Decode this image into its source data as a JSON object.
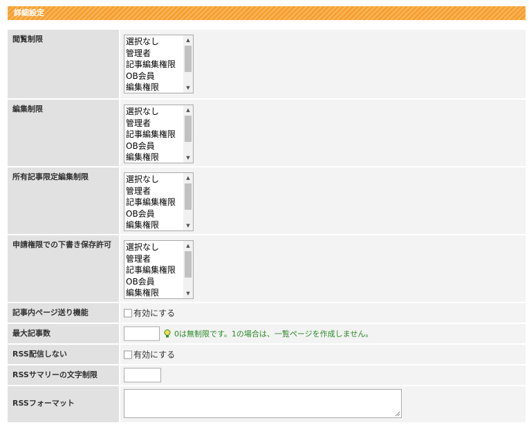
{
  "section": {
    "title": "詳細設定"
  },
  "permission_options": [
    "選択なし",
    "管理者",
    "記事編集権限",
    "OB会員",
    "編集権限"
  ],
  "rows": {
    "view_restriction": {
      "label": "閲覧制限"
    },
    "edit_restriction": {
      "label": "編集制限"
    },
    "owned_edit_restriction": {
      "label": "所有記事限定編集制限"
    },
    "draft_save_permission": {
      "label": "申請権限での下書き保存許可"
    },
    "in_article_paging": {
      "label": "記事内ページ送り機能",
      "checkbox_label": "有効にする",
      "checked": false
    },
    "max_articles": {
      "label": "最大記事数",
      "value": "",
      "hint": "0は無制限です。1の場合は、一覧ページを作成しません。"
    },
    "no_rss": {
      "label": "RSS配信しない",
      "checkbox_label": "有効にする",
      "checked": false
    },
    "rss_summary_limit": {
      "label": "RSSサマリーの文字制限",
      "value": ""
    },
    "rss_format": {
      "label": "RSSフォーマット",
      "value": ""
    }
  },
  "colors": {
    "header": "#f6a030",
    "label_bg": "#e1e1e1",
    "value_bg": "#f3f3f3",
    "hint": "#2c8a2c"
  },
  "icons": {
    "hint": "lightbulb-icon"
  }
}
